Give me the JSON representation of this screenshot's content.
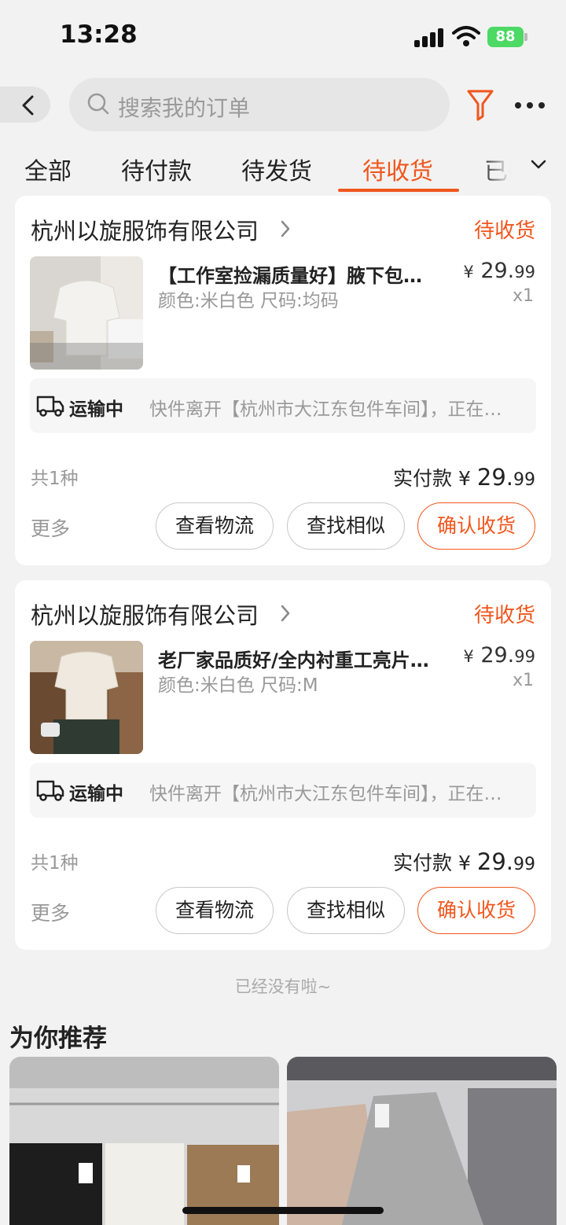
{
  "status_bar": {
    "time": "13:28",
    "battery": "88"
  },
  "search": {
    "placeholder": "搜索我的订单"
  },
  "tabs": [
    {
      "label": "全部",
      "active": false
    },
    {
      "label": "待付款",
      "active": false
    },
    {
      "label": "待发货",
      "active": false
    },
    {
      "label": "待收货",
      "active": true
    },
    {
      "label": "已l",
      "active": false
    }
  ],
  "orders": [
    {
      "shop": "杭州以旋服饰有限公司",
      "status": "待收货",
      "title": "【工作室捡漏质量好】腋下包…",
      "spec": "颜色:米白色 尺码:均码",
      "price_symbol": "¥",
      "price_int": "29.",
      "price_dec": "99",
      "qty": "x1",
      "logistics_label": "运输中",
      "logistics_text": "快件离开【杭州市大江东包件车间】，正在…",
      "count": "共1种",
      "paid_label": "实付款",
      "paid_symbol": "¥",
      "paid_int": "29.",
      "paid_dec": "99",
      "more": "更多",
      "btn_logistics": "查看物流",
      "btn_similar": "查找相似",
      "btn_confirm": "确认收货"
    },
    {
      "shop": "杭州以旋服饰有限公司",
      "status": "待收货",
      "title": "老厂家品质好/全内衬重工亮片…",
      "spec": "颜色:米白色 尺码:M",
      "price_symbol": "¥",
      "price_int": "29.",
      "price_dec": "99",
      "qty": "x1",
      "logistics_label": "运输中",
      "logistics_text": "快件离开【杭州市大江东包件车间】，正在…",
      "count": "共1种",
      "paid_label": "实付款",
      "paid_symbol": "¥",
      "paid_int": "29.",
      "paid_dec": "99",
      "more": "更多",
      "btn_logistics": "查看物流",
      "btn_similar": "查找相似",
      "btn_confirm": "确认收货"
    }
  ],
  "end_text": "已经没有啦~",
  "recommend_title": "为你推荐",
  "colors": {
    "accent": "#f0561c",
    "muted": "#999999",
    "background": "#f2f2f2"
  },
  "icons": [
    "back-arrow-icon",
    "search-icon",
    "filter-icon",
    "more-dots-icon",
    "chevron-down-icon",
    "chevron-right-icon",
    "truck-icon"
  ]
}
